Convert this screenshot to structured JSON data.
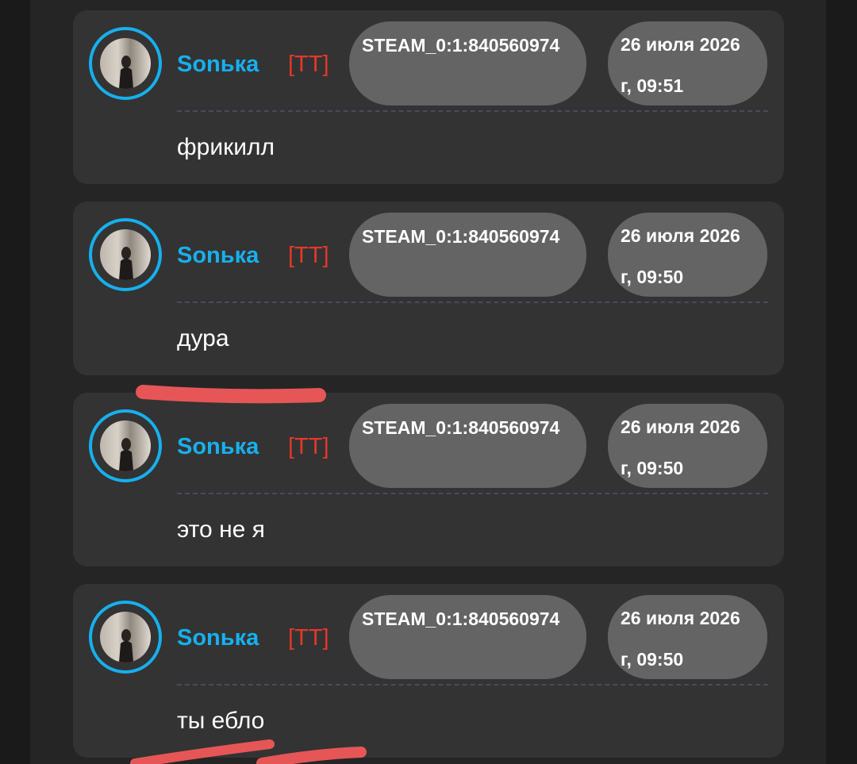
{
  "messages": [
    {
      "author": "Sonька",
      "tag": "[TT]",
      "steam_id": "STEAM_0:1:840560974",
      "date_line1": "26 июля 2026",
      "date_line2": "г, 09:51",
      "text": "фрикилл"
    },
    {
      "author": "Sonька",
      "tag": "[TT]",
      "steam_id": "STEAM_0:1:840560974",
      "date_line1": "26 июля 2026",
      "date_line2": "г, 09:50",
      "text": "дура"
    },
    {
      "author": "Sonька",
      "tag": "[TT]",
      "steam_id": "STEAM_0:1:840560974",
      "date_line1": "26 июля 2026",
      "date_line2": "г, 09:50",
      "text": "это не я"
    },
    {
      "author": "Sonька",
      "tag": "[TT]",
      "steam_id": "STEAM_0:1:840560974",
      "date_line1": "26 июля 2026",
      "date_line2": "г, 09:50",
      "text": "ты ебло"
    }
  ],
  "colors": {
    "author": "#16b0ee",
    "tag": "#e5382b",
    "card": "#333333",
    "pill": "#646464",
    "highlight": "#e65656"
  }
}
